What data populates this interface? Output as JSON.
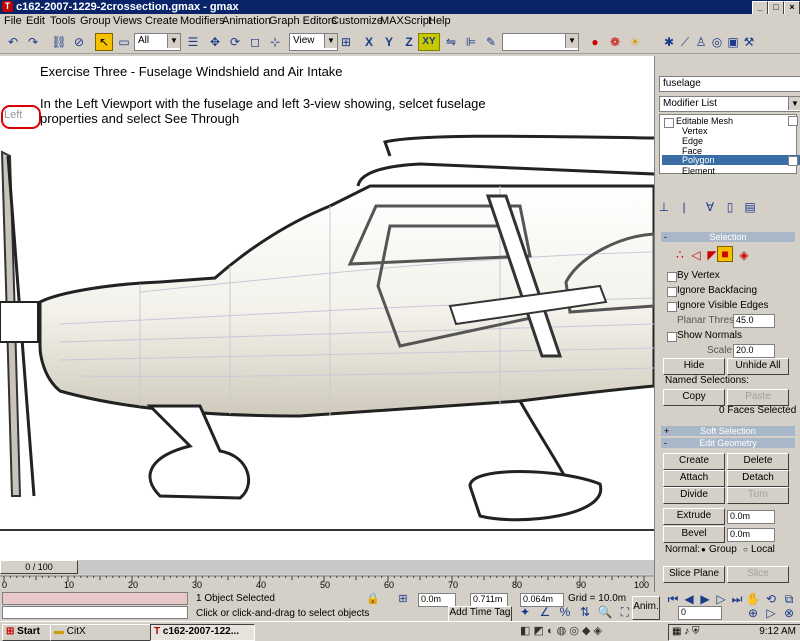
{
  "window": {
    "title": "c162-2007-1229-2crossection.gmax - gmax",
    "controls": {
      "minimize": "_",
      "maximize": "□",
      "close": "×"
    }
  },
  "menu": [
    "File",
    "Edit",
    "Tools",
    "Group",
    "Views",
    "Create",
    "Modifiers",
    "Animation",
    "Graph Editors",
    "Customize",
    "MAXScript",
    "Help"
  ],
  "toolbar": {
    "selection_filter": "All",
    "reference_coord": "View",
    "axis_constraint_active": "XY",
    "x_label": "X",
    "y_label": "Y",
    "z_label": "Z"
  },
  "viewport": {
    "label": "Left",
    "note_title": "Exercise Three - Fuselage  Windshield and Air Intake",
    "note_line1": "In the Left Viewport with the fuselage and left 3-view showing, selcet fuselage",
    "note_line2": "properties and select See Through"
  },
  "panel": {
    "object_name": "fuselage",
    "modifier_list": "Modifier List",
    "stack": [
      "Editable Mesh",
      "Vertex",
      "Edge",
      "Face",
      "Polygon",
      "Element"
    ],
    "stack_selected": "Polygon",
    "selection_title": "Selection",
    "by_vertex": "By Vertex",
    "ignore_backfacing": "Ignore Backfacing",
    "ignore_visible_edges": "Ignore Visible Edges",
    "planar_thresh_label": "Planar Thresh:",
    "planar_thresh_value": "45.0",
    "show_normals": "Show Normals",
    "scale_label": "Scale:",
    "scale_value": "20.0",
    "hide": "Hide",
    "unhide_all": "Unhide All",
    "named_selections": "Named Selections:",
    "copy": "Copy",
    "paste": "Paste",
    "faces_selected": "0 Faces Selected",
    "soft_selection": "Soft Selection",
    "edit_geometry": "Edit Geometry",
    "create": "Create",
    "delete": "Delete",
    "attach": "Attach",
    "detach": "Detach",
    "divide": "Divide",
    "turn": "Turn",
    "extrude": "Extrude",
    "extrude_value": "0.0m",
    "bevel": "Bevel",
    "bevel_value": "0.0m",
    "normal_label": "Normal:",
    "group": "Group",
    "local": "Local",
    "slice_plane": "Slice Plane",
    "slice": "Slice"
  },
  "timeline": {
    "frame": "0 / 100",
    "ticks": [
      "0",
      "10",
      "20",
      "30",
      "40",
      "50",
      "60",
      "70",
      "80",
      "90",
      "100"
    ]
  },
  "status": {
    "objects_selected": "1 Object Selected",
    "prompt": "Click or click-and-drag to select objects",
    "x_value": "0.0m",
    "y_value": "0.711m",
    "z_value": "0.064m",
    "grid": "Grid = 10.0m",
    "add_time_tag": "Add Time Tag",
    "anim": "Anim.",
    "frame_field": "0"
  },
  "taskbar": {
    "start": "Start",
    "task1": "CitX",
    "task2": "c162-2007-122...",
    "clock": "9:12 AM"
  },
  "colors": {
    "titlebar": "#0a246a",
    "selected_stack": "#3a6ea5",
    "rollout": "#a9b8c8",
    "active_tool": "#f5c000"
  }
}
